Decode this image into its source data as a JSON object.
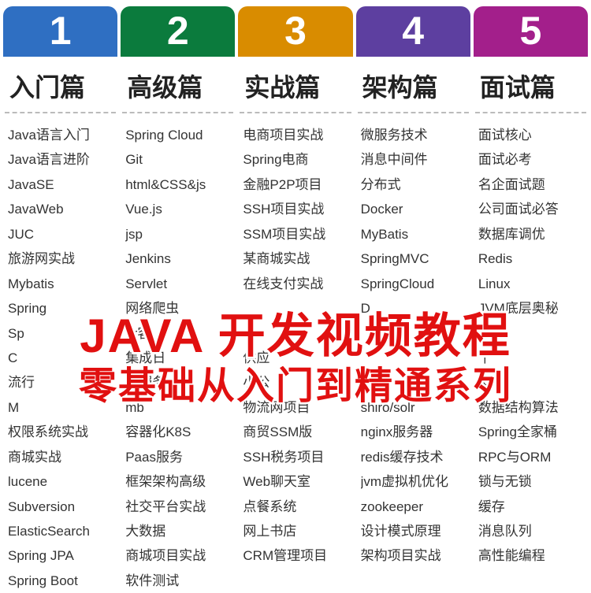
{
  "overlay": {
    "main": "JAVA 开发视频教程",
    "sub": "零基础从入门到精通系列"
  },
  "columns": [
    {
      "number": "1",
      "title": "入门篇",
      "items": [
        "Java语言入门",
        "Java语言进阶",
        "JavaSE",
        "JavaWeb",
        "JUC",
        "旅游网实战",
        "Mybatis",
        "Spring",
        "Sp",
        "C",
        "流行",
        "M",
        "权限系统实战",
        "商城实战",
        "lucene",
        "Subversion",
        "ElasticSearch",
        "Spring JPA",
        "Spring Boot"
      ]
    },
    {
      "number": "2",
      "title": "高级篇",
      "items": [
        "Spring Cloud",
        "Git",
        "html&CSS&js",
        "Vue.js",
        "jsp",
        "Jenkins",
        "Servlet",
        "网络爬虫",
        "er客",
        "集成日",
        "微服务",
        "mb",
        "容器化K8S",
        "Paas服务",
        "框架架构高级",
        "社交平台实战",
        "大数据",
        "商城项目实战",
        "软件测试"
      ]
    },
    {
      "number": "3",
      "title": "实战篇",
      "items": [
        "电商项目实战",
        "Spring电商",
        "金融P2P项目",
        "SSH项目实战",
        "SSM项目实战",
        "某商城实战",
        "在线支付实战",
        "",
        "",
        "供应",
        "小公",
        "物流网项目",
        "商贸SSM版",
        "SSH税务项目",
        "Web聊天室",
        "点餐系统",
        "网上书店",
        "CRM管理项目"
      ]
    },
    {
      "number": "4",
      "title": "架构篇",
      "items": [
        "微服务技术",
        "消息中间件",
        "分布式",
        "Docker",
        "MyBatis",
        "SpringMVC",
        "SpringCloud",
        "D",
        "",
        "",
        "",
        "shiro/solr",
        "nginx服务器",
        "redis缓存技术",
        "jvm虚拟机优化",
        "zookeeper",
        "设计模式原理",
        "架构项目实战"
      ]
    },
    {
      "number": "5",
      "title": "面试篇",
      "items": [
        "面试核心",
        "面试必考",
        "名企面试题",
        "公司面试必答",
        "数据库调优",
        "Redis",
        "Linux",
        "JVM底层奥秘",
        "",
        "千",
        "发",
        "数据结构算法",
        "Spring全家桶",
        "RPC与ORM",
        "锁与无锁",
        "缓存",
        "消息队列",
        "高性能编程"
      ]
    }
  ]
}
